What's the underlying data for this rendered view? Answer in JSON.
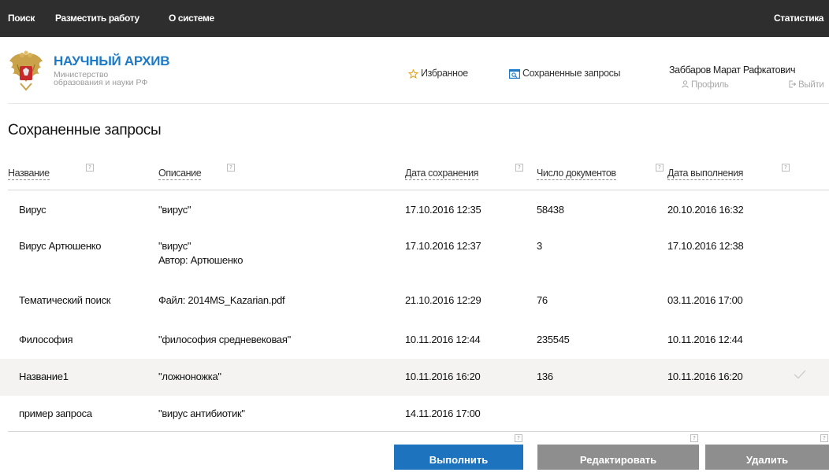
{
  "topnav": {
    "search": "Поиск",
    "post_work": "Разместить работу",
    "about": "О системе",
    "stats": "Статистика"
  },
  "brand": {
    "title": "НАУЧНЫЙ АРХИВ",
    "subtitle_line1": "Министерство",
    "subtitle_line2": "образования и науки РФ",
    "logo_icon": "coat-of-arms-icon"
  },
  "header": {
    "favorites": "Избранное",
    "saved_queries": "Сохраненные запросы",
    "user_name": "Заббаров Марат Рафкатович",
    "profile": "Профиль",
    "logout": "Выйти"
  },
  "page": {
    "title": "Сохраненные запросы"
  },
  "table": {
    "columns": [
      "Название",
      "Описание",
      "Дата сохранения",
      "Число документов",
      "Дата выполнения"
    ],
    "help_glyph": "?",
    "rows": [
      {
        "name": "Вирус",
        "desc": "\"вирус\"",
        "desc2": "",
        "saved": "17.10.2016 12:35",
        "docs": "58438",
        "executed": "20.10.2016 16:32",
        "selected": false
      },
      {
        "name": "Вирус Артюшенко",
        "desc": "\"вирус\"",
        "desc2": "Автор: Артюшенко",
        "saved": "17.10.2016 12:37",
        "docs": "3",
        "executed": "17.10.2016 12:38",
        "selected": false
      },
      {
        "name": "Тематический поиск",
        "desc": "Файл: 2014MS_Kazarian.pdf",
        "desc2": "",
        "saved": "21.10.2016 12:29",
        "docs": "76",
        "executed": "03.11.2016 17:00",
        "selected": false
      },
      {
        "name": "Философия",
        "desc": "\"философия средневековая\"",
        "desc2": "",
        "saved": "10.11.2016 12:44",
        "docs": "235545",
        "executed": "10.11.2016 12:44",
        "selected": false
      },
      {
        "name": "Название1",
        "desc": "\"ложноножка\"",
        "desc2": "",
        "saved": "10.11.2016 16:20",
        "docs": "136",
        "executed": "10.11.2016 16:20",
        "selected": true
      },
      {
        "name": "пример запроса",
        "desc": "\"вирус антибиотик\"",
        "desc2": "",
        "saved": "14.11.2016 17:00",
        "docs": "",
        "executed": "",
        "selected": false
      }
    ]
  },
  "actions": {
    "execute": "Выполнить",
    "edit": "Редактировать",
    "delete": "Удалить"
  },
  "colors": {
    "topbar": "#2e2e2e",
    "brand": "#1f7ac6",
    "primary_button": "#1e73be",
    "secondary_button": "#8e8e8e",
    "selected_row": "#f4f3f1"
  }
}
